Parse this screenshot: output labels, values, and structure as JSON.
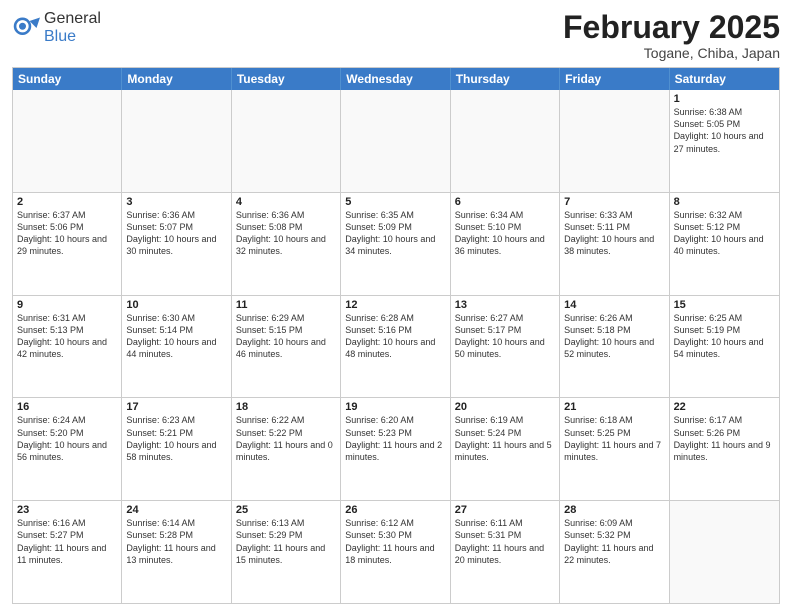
{
  "header": {
    "logo_general": "General",
    "logo_blue": "Blue",
    "title": "February 2025",
    "location": "Togane, Chiba, Japan"
  },
  "weekdays": [
    "Sunday",
    "Monday",
    "Tuesday",
    "Wednesday",
    "Thursday",
    "Friday",
    "Saturday"
  ],
  "rows": [
    [
      {
        "day": "",
        "info": ""
      },
      {
        "day": "",
        "info": ""
      },
      {
        "day": "",
        "info": ""
      },
      {
        "day": "",
        "info": ""
      },
      {
        "day": "",
        "info": ""
      },
      {
        "day": "",
        "info": ""
      },
      {
        "day": "1",
        "info": "Sunrise: 6:38 AM\nSunset: 5:05 PM\nDaylight: 10 hours and 27 minutes."
      }
    ],
    [
      {
        "day": "2",
        "info": "Sunrise: 6:37 AM\nSunset: 5:06 PM\nDaylight: 10 hours and 29 minutes."
      },
      {
        "day": "3",
        "info": "Sunrise: 6:36 AM\nSunset: 5:07 PM\nDaylight: 10 hours and 30 minutes."
      },
      {
        "day": "4",
        "info": "Sunrise: 6:36 AM\nSunset: 5:08 PM\nDaylight: 10 hours and 32 minutes."
      },
      {
        "day": "5",
        "info": "Sunrise: 6:35 AM\nSunset: 5:09 PM\nDaylight: 10 hours and 34 minutes."
      },
      {
        "day": "6",
        "info": "Sunrise: 6:34 AM\nSunset: 5:10 PM\nDaylight: 10 hours and 36 minutes."
      },
      {
        "day": "7",
        "info": "Sunrise: 6:33 AM\nSunset: 5:11 PM\nDaylight: 10 hours and 38 minutes."
      },
      {
        "day": "8",
        "info": "Sunrise: 6:32 AM\nSunset: 5:12 PM\nDaylight: 10 hours and 40 minutes."
      }
    ],
    [
      {
        "day": "9",
        "info": "Sunrise: 6:31 AM\nSunset: 5:13 PM\nDaylight: 10 hours and 42 minutes."
      },
      {
        "day": "10",
        "info": "Sunrise: 6:30 AM\nSunset: 5:14 PM\nDaylight: 10 hours and 44 minutes."
      },
      {
        "day": "11",
        "info": "Sunrise: 6:29 AM\nSunset: 5:15 PM\nDaylight: 10 hours and 46 minutes."
      },
      {
        "day": "12",
        "info": "Sunrise: 6:28 AM\nSunset: 5:16 PM\nDaylight: 10 hours and 48 minutes."
      },
      {
        "day": "13",
        "info": "Sunrise: 6:27 AM\nSunset: 5:17 PM\nDaylight: 10 hours and 50 minutes."
      },
      {
        "day": "14",
        "info": "Sunrise: 6:26 AM\nSunset: 5:18 PM\nDaylight: 10 hours and 52 minutes."
      },
      {
        "day": "15",
        "info": "Sunrise: 6:25 AM\nSunset: 5:19 PM\nDaylight: 10 hours and 54 minutes."
      }
    ],
    [
      {
        "day": "16",
        "info": "Sunrise: 6:24 AM\nSunset: 5:20 PM\nDaylight: 10 hours and 56 minutes."
      },
      {
        "day": "17",
        "info": "Sunrise: 6:23 AM\nSunset: 5:21 PM\nDaylight: 10 hours and 58 minutes."
      },
      {
        "day": "18",
        "info": "Sunrise: 6:22 AM\nSunset: 5:22 PM\nDaylight: 11 hours and 0 minutes."
      },
      {
        "day": "19",
        "info": "Sunrise: 6:20 AM\nSunset: 5:23 PM\nDaylight: 11 hours and 2 minutes."
      },
      {
        "day": "20",
        "info": "Sunrise: 6:19 AM\nSunset: 5:24 PM\nDaylight: 11 hours and 5 minutes."
      },
      {
        "day": "21",
        "info": "Sunrise: 6:18 AM\nSunset: 5:25 PM\nDaylight: 11 hours and 7 minutes."
      },
      {
        "day": "22",
        "info": "Sunrise: 6:17 AM\nSunset: 5:26 PM\nDaylight: 11 hours and 9 minutes."
      }
    ],
    [
      {
        "day": "23",
        "info": "Sunrise: 6:16 AM\nSunset: 5:27 PM\nDaylight: 11 hours and 11 minutes."
      },
      {
        "day": "24",
        "info": "Sunrise: 6:14 AM\nSunset: 5:28 PM\nDaylight: 11 hours and 13 minutes."
      },
      {
        "day": "25",
        "info": "Sunrise: 6:13 AM\nSunset: 5:29 PM\nDaylight: 11 hours and 15 minutes."
      },
      {
        "day": "26",
        "info": "Sunrise: 6:12 AM\nSunset: 5:30 PM\nDaylight: 11 hours and 18 minutes."
      },
      {
        "day": "27",
        "info": "Sunrise: 6:11 AM\nSunset: 5:31 PM\nDaylight: 11 hours and 20 minutes."
      },
      {
        "day": "28",
        "info": "Sunrise: 6:09 AM\nSunset: 5:32 PM\nDaylight: 11 hours and 22 minutes."
      },
      {
        "day": "",
        "info": ""
      }
    ]
  ]
}
